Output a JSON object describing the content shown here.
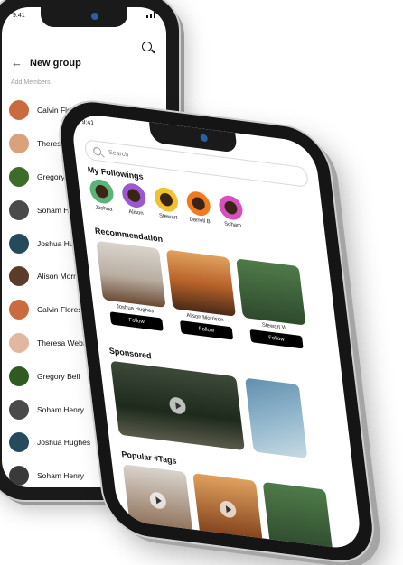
{
  "back_phone": {
    "status_time": "9:41",
    "header_title": "New group",
    "sub_label": "Add Members",
    "members": [
      {
        "name": "Calvin Flores",
        "color": "#c96a3f"
      },
      {
        "name": "Theresa Webb",
        "color": "#d9a27d"
      },
      {
        "name": "Gregory Bell",
        "color": "#3c6b2a"
      },
      {
        "name": "Soham Henry",
        "color": "#4a4a4a"
      },
      {
        "name": "Joshua Hughes",
        "color": "#244a5c"
      },
      {
        "name": "Alison Morrison",
        "color": "#5a3c2a"
      },
      {
        "name": "Calvin Flores",
        "color": "#c96a3f"
      },
      {
        "name": "Theresa Webb",
        "color": "#e2b7a0"
      },
      {
        "name": "Gregory Bell",
        "color": "#2f5a22"
      },
      {
        "name": "Soham Henry",
        "color": "#4a4a4a"
      },
      {
        "name": "Joshua Hughes",
        "color": "#244a5c"
      },
      {
        "name": "Soham Henry",
        "color": "#3a3a3a"
      }
    ]
  },
  "front_phone": {
    "status_time": "9:41",
    "search_placeholder": "Search",
    "followings_title": "My Followings",
    "followings": [
      {
        "name": "Joshua",
        "color": "#5bb37a"
      },
      {
        "name": "Alison",
        "color": "#9b59d0"
      },
      {
        "name": "Stewart",
        "color": "#f2c12e"
      },
      {
        "name": "Darrell B.",
        "color": "#f07b1f"
      },
      {
        "name": "Soham",
        "color": "#d650c0"
      }
    ],
    "recommendation_title": "Recommendation",
    "recommendations": [
      {
        "name": "Joshua Hughes",
        "follow_label": "Follow"
      },
      {
        "name": "Alison Morrison",
        "follow_label": "Follow"
      },
      {
        "name": "Stewart W.",
        "follow_label": "Follow"
      }
    ],
    "sponsored_title": "Sponsored",
    "tags_title": "Popular #Tags"
  }
}
